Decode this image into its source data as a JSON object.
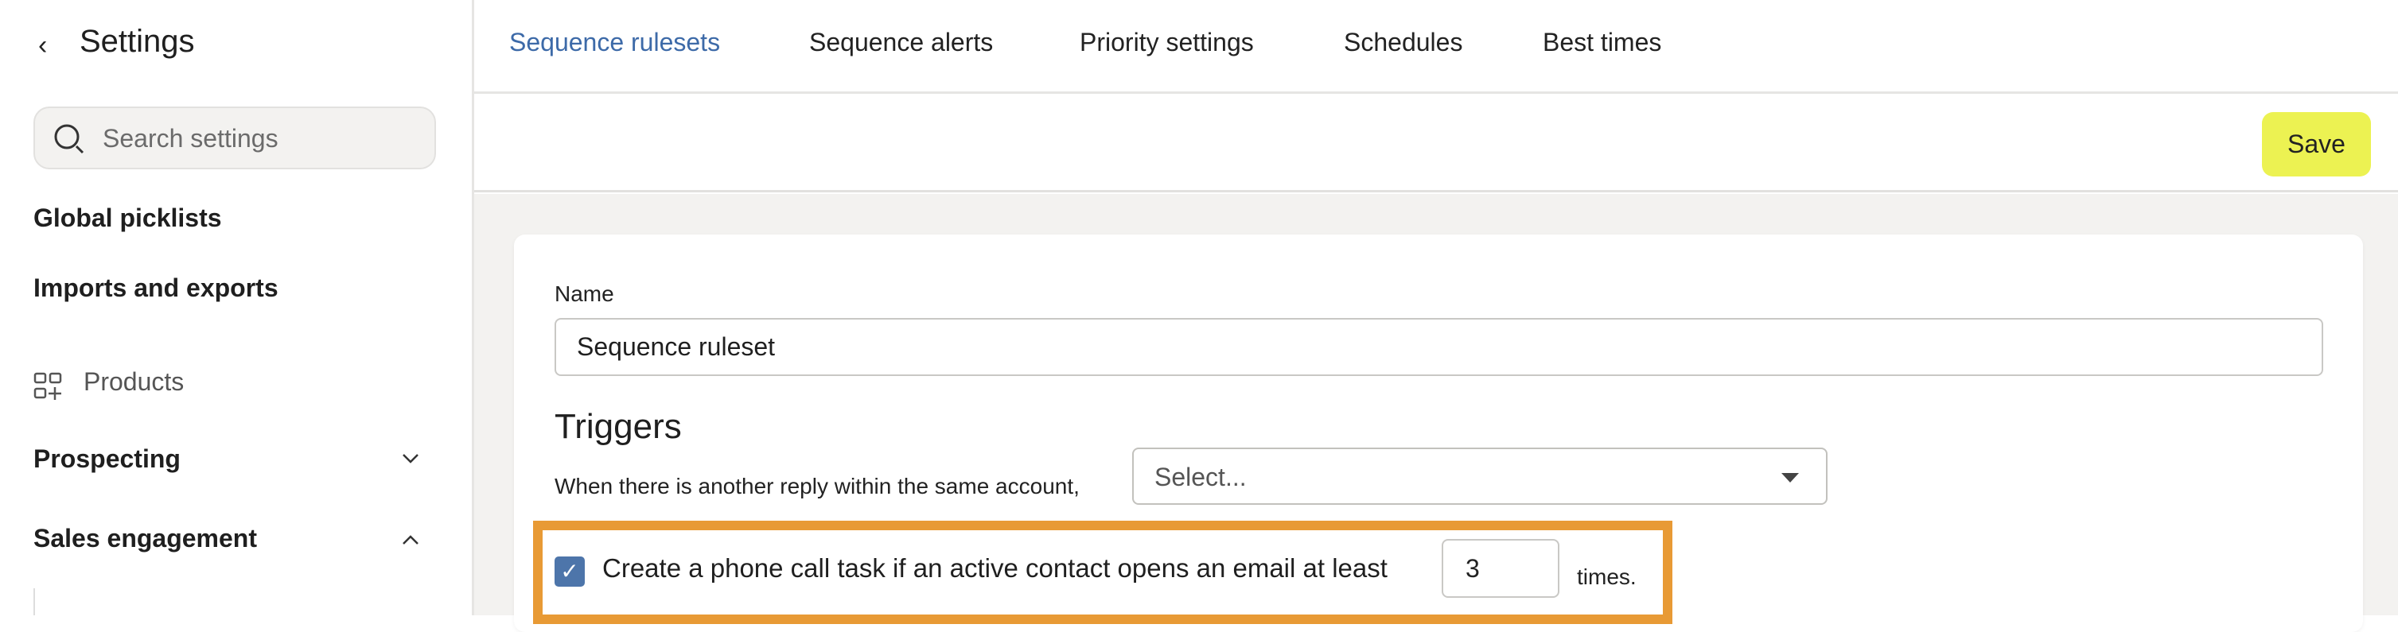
{
  "sidebar": {
    "title": "Settings",
    "search_placeholder": "Search settings",
    "items": [
      {
        "label": "Global picklists"
      },
      {
        "label": "Imports and exports"
      },
      {
        "label": "Products",
        "icon": "grid-plus-icon"
      },
      {
        "label": "Prospecting",
        "icon": "chevron-down-icon"
      },
      {
        "label": "Sales engagement",
        "icon": "chevron-up-icon"
      }
    ]
  },
  "tabs": [
    {
      "label": "Sequence rulesets",
      "active": true
    },
    {
      "label": "Sequence alerts"
    },
    {
      "label": "Priority settings"
    },
    {
      "label": "Schedules"
    },
    {
      "label": "Best times"
    }
  ],
  "toolbar": {
    "save_label": "Save"
  },
  "form": {
    "name_label": "Name",
    "name_value": "Sequence ruleset",
    "triggers_heading": "Triggers",
    "reply_label": "When there is another reply within the same account,",
    "reply_select": "Select...",
    "call_task_checked": true,
    "call_task_label": "Create a phone call task if an active contact opens an email at least",
    "call_task_count": "3",
    "call_task_suffix": "times."
  },
  "colors": {
    "accent": "#3d6aa8",
    "save": "#ecf252",
    "highlight": "#e89a35",
    "checkbox": "#4d75aa"
  }
}
